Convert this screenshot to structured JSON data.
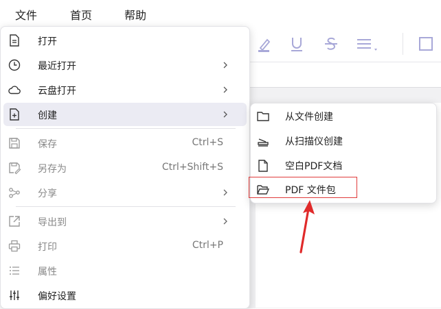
{
  "menubar": {
    "file": "文件",
    "home": "首页",
    "help": "帮助"
  },
  "toolbar": {
    "icons": [
      "highlight-icon",
      "underline-icon",
      "strikethrough-icon",
      "align-menu-icon",
      "square-icon"
    ]
  },
  "file_menu": {
    "items": [
      {
        "label": "打开",
        "icon": "document-icon"
      },
      {
        "label": "最近打开",
        "icon": "clock-icon",
        "submenu": true
      },
      {
        "label": "云盘打开",
        "icon": "cloud-icon",
        "submenu": true
      },
      {
        "label": "创建",
        "icon": "new-document-icon",
        "submenu": true,
        "active": true
      },
      {
        "label": "保存",
        "icon": "save-icon",
        "shortcut": "Ctrl+S",
        "disabled": true
      },
      {
        "label": "另存为",
        "icon": "save-as-icon",
        "shortcut": "Ctrl+Shift+S",
        "disabled": true
      },
      {
        "label": "分享",
        "icon": "share-icon",
        "submenu": true,
        "disabled": true
      },
      {
        "label": "导出到",
        "icon": "export-icon",
        "submenu": true,
        "disabled": true
      },
      {
        "label": "打印",
        "icon": "print-icon",
        "shortcut": "Ctrl+P",
        "disabled": true
      },
      {
        "label": "属性",
        "icon": "list-icon",
        "disabled": true
      },
      {
        "label": "偏好设置",
        "icon": "sliders-icon"
      }
    ]
  },
  "create_submenu": {
    "items": [
      {
        "label": "从文件创建",
        "icon": "folder-icon"
      },
      {
        "label": "从扫描仪创建",
        "icon": "scanner-icon"
      },
      {
        "label": "空白PDF文档",
        "icon": "blank-page-icon"
      },
      {
        "label": "PDF 文件包",
        "icon": "open-folder-icon",
        "highlighted": true
      }
    ]
  },
  "colors": {
    "active_row": "#ebebf3",
    "highlight_border": "#e03a3a",
    "arrow": "#e02a2a",
    "toolbar_icon": "#a8a8d8"
  }
}
